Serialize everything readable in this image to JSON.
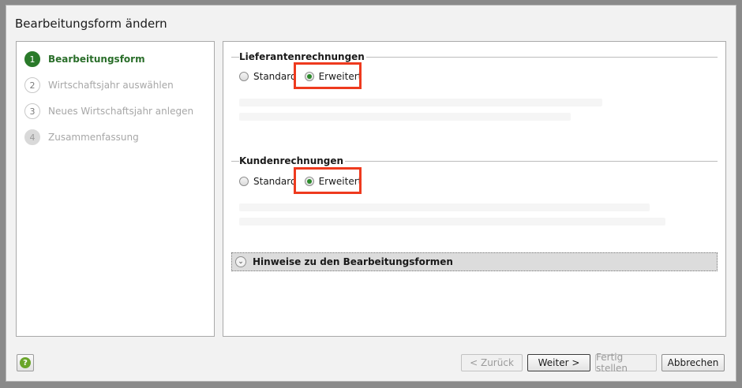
{
  "dialog": {
    "title": "Bearbeitungsform ändern"
  },
  "steps": [
    {
      "number": "1",
      "label": "Bearbeitungsform",
      "state": "active"
    },
    {
      "number": "2",
      "label": "Wirtschaftsjahr auswählen",
      "state": "inactive"
    },
    {
      "number": "3",
      "label": "Neues Wirtschaftsjahr anlegen",
      "state": "inactive"
    },
    {
      "number": "4",
      "label": "Zusammenfassung",
      "state": "disabled"
    }
  ],
  "groups": {
    "lieferanten": {
      "title": "Lieferantenrechnungen",
      "options": [
        "Standard",
        "Erweitert"
      ],
      "selected": "Erweitert"
    },
    "kunden": {
      "title": "Kundenrechnungen",
      "options": [
        "Standard",
        "Erweitert"
      ],
      "selected": "Erweitert"
    }
  },
  "expander": {
    "label": "Hinweise zu den Bearbeitungsformen",
    "icon": "chevron-down-icon"
  },
  "footer": {
    "help_icon": "help-icon",
    "back_label": "< Zurück",
    "next_label": "Weiter >",
    "finish_label": "Fertig stellen",
    "cancel_label": "Abbrechen"
  },
  "colors": {
    "accent": "#2a7a2a",
    "highlight": "#ee3a1e"
  }
}
